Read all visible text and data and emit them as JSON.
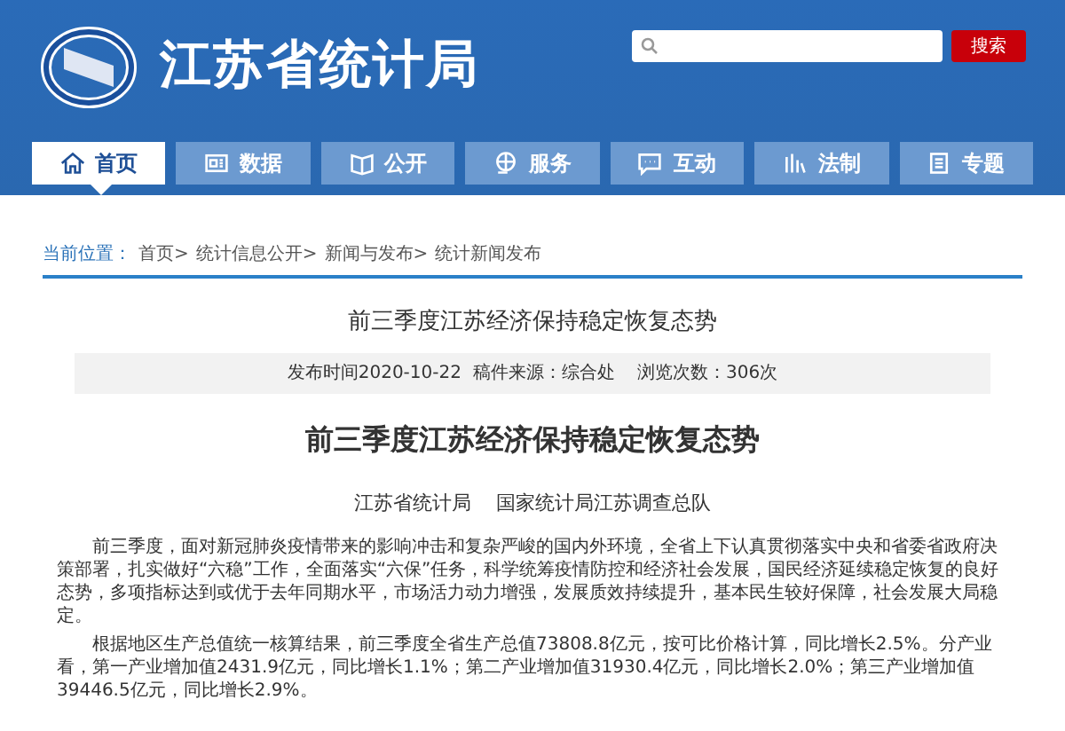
{
  "header": {
    "site_title": "江苏省统计局",
    "search_button": "搜索"
  },
  "nav": [
    {
      "label": "首页",
      "selected": true
    },
    {
      "label": "数据",
      "selected": false
    },
    {
      "label": "公开",
      "selected": false
    },
    {
      "label": "服务",
      "selected": false
    },
    {
      "label": "互动",
      "selected": false
    },
    {
      "label": "法制",
      "selected": false
    },
    {
      "label": "专题",
      "selected": false
    }
  ],
  "breadcrumb": {
    "label": "当前位置：",
    "items": [
      "首页>",
      "统计信息公开>",
      "新闻与发布>",
      "统计新闻发布"
    ]
  },
  "article": {
    "title": "前三季度江苏经济保持稳定恢复态势",
    "meta": "发布时间2020-10-22  稿件来源：综合处    浏览次数：306次",
    "heading": "前三季度江苏经济保持稳定恢复态势",
    "authors": [
      "江苏省统计局",
      "国家统计局江苏调查总队"
    ],
    "paragraphs": [
      "前三季度，面对新冠肺炎疫情带来的影响冲击和复杂严峻的国内外环境，全省上下认真贯彻落实中央和省委省政府决策部署，扎实做好“六稳”工作，全面落实“六保”任务，科学统筹疫情防控和经济社会发展，国民经济延续稳定恢复的良好态势，多项指标达到或优于去年同期水平，市场活力动力增强，发展质效持续提升，基本民生较好保障，社会发展大局稳定。",
      "根据地区生产总值统一核算结果，前三季度全省生产总值73808.8亿元，按可比价格计算，同比增长2.5%。分产业看，第一产业增加值2431.9亿元，同比增长1.1%；第二产业增加值31930.4亿元，同比增长2.0%；第三产业增加值39446.5亿元，同比增长2.9%。"
    ]
  }
}
